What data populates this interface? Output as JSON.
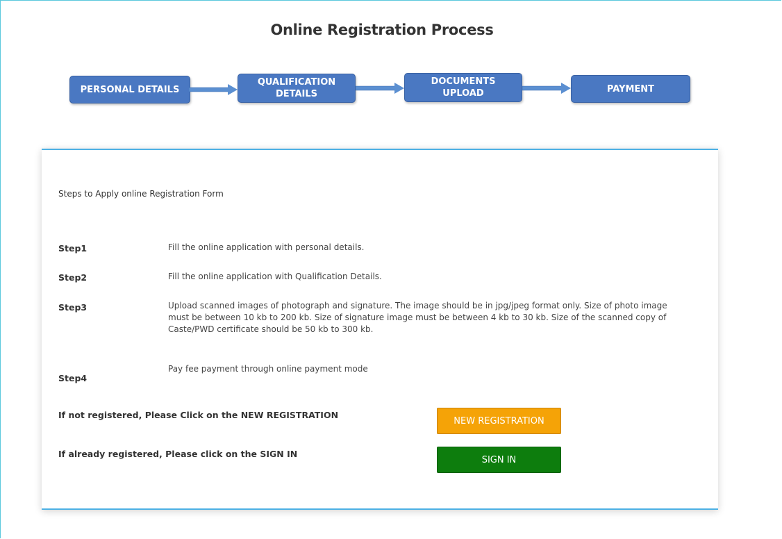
{
  "page": {
    "title": "Online Registration Process"
  },
  "process_steps": [
    {
      "label": "PERSONAL DETAILS"
    },
    {
      "label": "QUALIFICATION DETAILS"
    },
    {
      "label": "DOCUMENTS UPLOAD"
    },
    {
      "label": "PAYMENT"
    }
  ],
  "instructions": {
    "heading": "Steps to Apply online Registration Form",
    "steps": [
      {
        "label": "Step1",
        "text": "Fill the online application with personal details."
      },
      {
        "label": "Step2",
        "text": "Fill the online application with Qualification Details."
      },
      {
        "label": "Step3",
        "text": "Upload scanned images of photograph and signature. The image should be in jpg/jpeg format only. Size of photo image must be between 10 kb to 200 kb. Size of signature image must be between 4 kb to 30 kb. Size of the scanned copy of Caste/PWD certificate should be 50 kb to 300 kb."
      },
      {
        "label": "Step4",
        "text": "Pay fee payment through online payment mode"
      }
    ]
  },
  "registration": {
    "new_prompt": "If not registered, Please Click on the NEW REGISTRATION",
    "new_button": "NEW REGISTRATION",
    "signin_prompt": "If already registered, Please click on the SIGN IN",
    "signin_button": "SIGN IN"
  },
  "colors": {
    "step_box": "#4a78c2",
    "arrow": "#5b8fd1",
    "new_button": "#f5a307",
    "signin_button": "#0d7d0d",
    "card_border": "#4cb0e4"
  }
}
